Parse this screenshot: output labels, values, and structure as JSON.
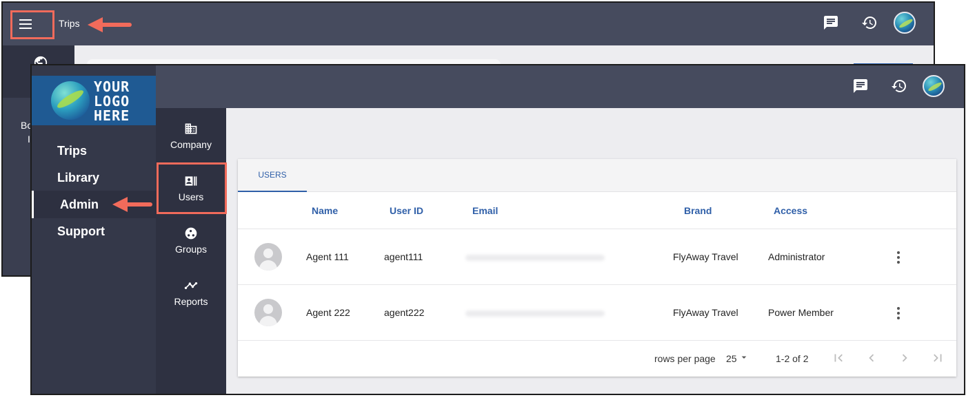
{
  "back_window": {
    "title": "Trips",
    "sidebar_text_1": "Bo",
    "sidebar_text_2": "In"
  },
  "front_window": {
    "logo": {
      "line1": "YOUR",
      "line2": "LOGO",
      "line3": "HERE"
    },
    "nav": [
      {
        "label": "Trips",
        "active": false
      },
      {
        "label": "Library",
        "active": false
      },
      {
        "label": "Admin",
        "active": true
      },
      {
        "label": "Support",
        "active": false
      }
    ],
    "rail": [
      {
        "label": "Company",
        "icon": "building-icon"
      },
      {
        "label": "Users",
        "icon": "contact-card-icon",
        "active": true
      },
      {
        "label": "Groups",
        "icon": "groups-icon"
      },
      {
        "label": "Reports",
        "icon": "trend-line-icon"
      }
    ],
    "tabs": [
      {
        "label": "USERS",
        "active": true
      }
    ],
    "table": {
      "headers": [
        "Name",
        "User ID",
        "Email",
        "Brand",
        "Access"
      ],
      "rows": [
        {
          "name": "Agent 111",
          "user_id": "agent111",
          "email": "",
          "brand": "FlyAway Travel",
          "access": "Administrator"
        },
        {
          "name": "Agent 222",
          "user_id": "agent222",
          "email": "",
          "brand": "FlyAway Travel",
          "access": "Power Member"
        }
      ]
    },
    "pagination": {
      "rows_per_page_label": "rows per page",
      "rows_per_page": "25",
      "range": "1-2 of 2"
    }
  },
  "colors": {
    "header": "#464b5e",
    "sidebar": "#343849",
    "rail": "#2e3141",
    "accent": "#2f5fa8",
    "annotation": "#f26b5b",
    "logo_bg": "#1f5a93"
  }
}
